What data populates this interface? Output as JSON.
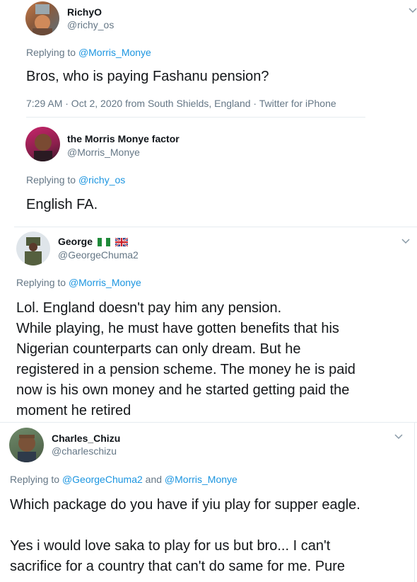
{
  "tweets": [
    {
      "name": "RichyO",
      "handle": "@richy_os",
      "replying_prefix": "Replying to ",
      "replying_to": "@Morris_Monye",
      "text": "Bros, who is paying Fashanu pension?",
      "meta": "7:29 AM · Oct 2, 2020 from South Shields, England · Twitter for iPhone"
    },
    {
      "name": "the Morris Monye factor",
      "handle": "@Morris_Monye",
      "replying_prefix": "Replying to ",
      "replying_to": "@richy_os",
      "text": "English FA."
    },
    {
      "name": "George",
      "handle": "@GeorgeChuma2",
      "replying_prefix": "Replying to ",
      "replying_to": "@Morris_Monye",
      "lines": [
        "Lol. England doesn't pay him any pension.",
        "While playing, he must have gotten benefits that his",
        "Nigerian counterparts can only dream. But he",
        "registered in a pension scheme. The money he is paid",
        "now is his own money and he started getting paid the",
        "moment he retired"
      ]
    },
    {
      "name": "Charles_Chizu",
      "handle": "@charleschizu",
      "replying_prefix": "Replying to ",
      "replying_to": "@GeorgeChuma2",
      "replying_and": " and ",
      "replying_to_2": "@Morris_Monye",
      "lines": [
        "Which package do you have if yiu play for supper eagle.",
        "",
        "Yes i would love saka to play for us but bro... I can't",
        "sacrifice for a country that can't do same for me. Pure"
      ]
    }
  ],
  "colors": {
    "link": "#1b95e0",
    "muted": "#657786",
    "text": "#14171a"
  },
  "icons": [
    "chevron-down-icon",
    "nigeria-flag-icon",
    "uk-flag-icon"
  ]
}
